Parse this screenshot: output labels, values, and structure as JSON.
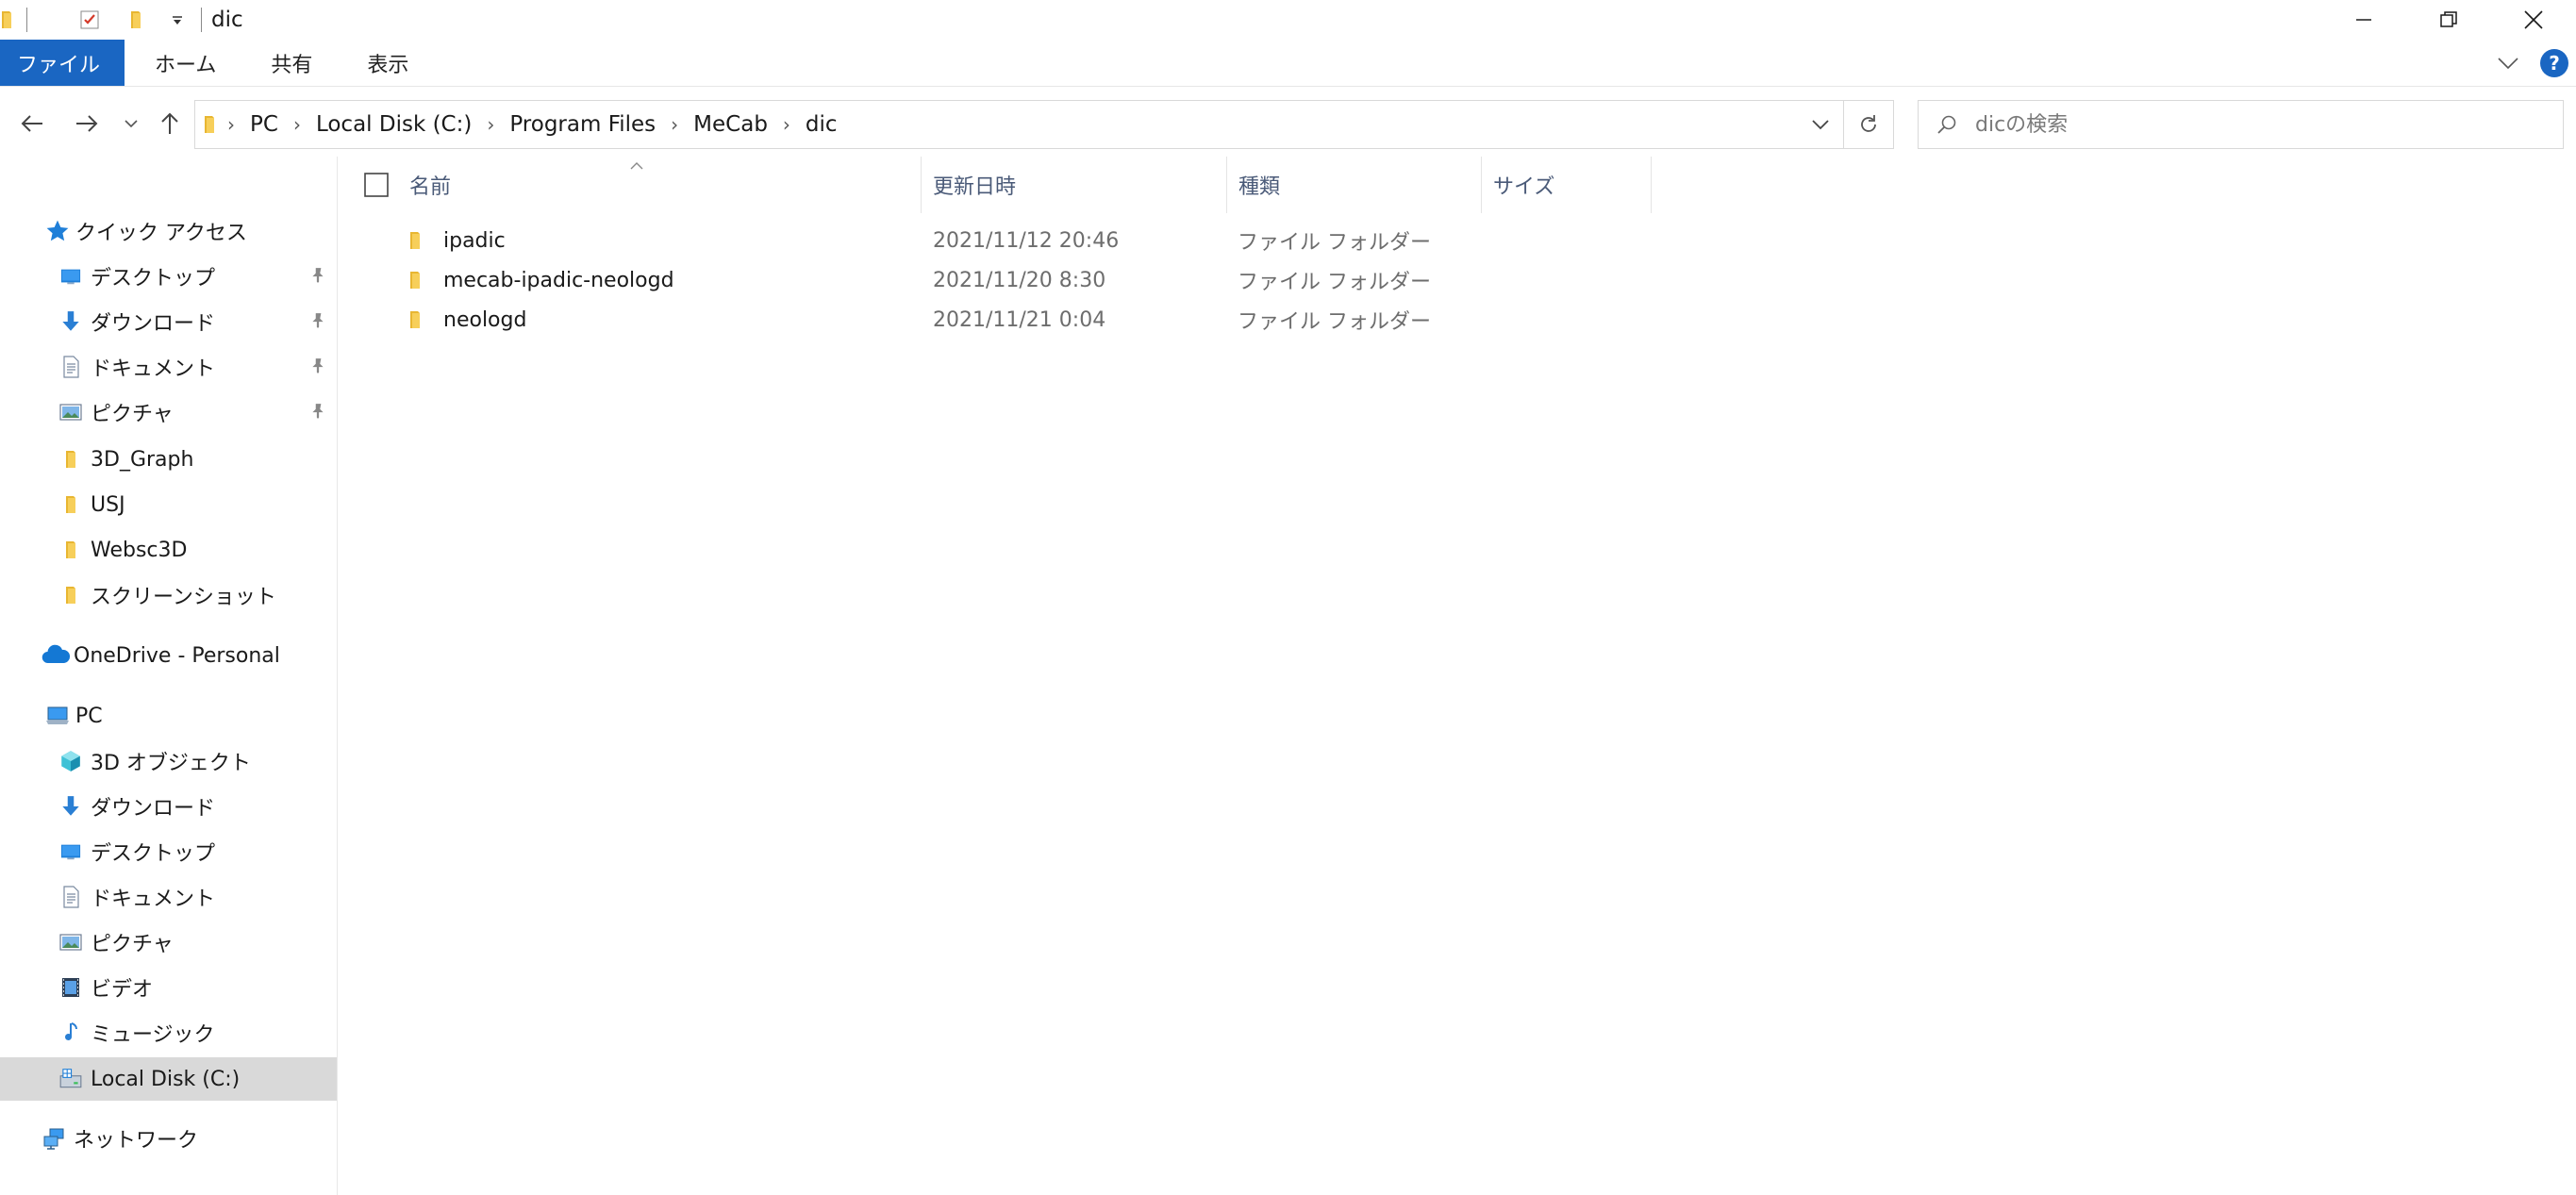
{
  "window": {
    "title": "dic",
    "controls": {
      "minimize": "minimize",
      "restore": "restore",
      "close": "close"
    }
  },
  "ribbon": {
    "tabs": [
      {
        "label": "ファイル",
        "active": true
      },
      {
        "label": "ホーム"
      },
      {
        "label": "共有"
      },
      {
        "label": "表示"
      }
    ],
    "help_label": "?"
  },
  "address": {
    "crumbs": [
      "PC",
      "Local Disk (C:)",
      "Program Files",
      "MeCab",
      "dic"
    ]
  },
  "search": {
    "placeholder": "dicの検索"
  },
  "navpane": {
    "quick_access": {
      "label": "クイック アクセス",
      "items": [
        {
          "label": "デスクトップ",
          "icon": "desktop-icon",
          "pinned": true
        },
        {
          "label": "ダウンロード",
          "icon": "download-icon",
          "pinned": true
        },
        {
          "label": "ドキュメント",
          "icon": "document-icon",
          "pinned": true
        },
        {
          "label": "ピクチャ",
          "icon": "pictures-icon",
          "pinned": true
        },
        {
          "label": "3D_Graph",
          "icon": "folder-icon"
        },
        {
          "label": "USJ",
          "icon": "folder-icon"
        },
        {
          "label": "Websc3D",
          "icon": "folder-icon"
        },
        {
          "label": "スクリーンショット",
          "icon": "folder-icon"
        }
      ]
    },
    "onedrive": {
      "label": "OneDrive - Personal"
    },
    "pc": {
      "label": "PC",
      "items": [
        {
          "label": "3D オブジェクト",
          "icon": "3d-objects-icon"
        },
        {
          "label": "ダウンロード",
          "icon": "download-icon"
        },
        {
          "label": "デスクトップ",
          "icon": "desktop-icon"
        },
        {
          "label": "ドキュメント",
          "icon": "document-icon"
        },
        {
          "label": "ピクチャ",
          "icon": "pictures-icon"
        },
        {
          "label": "ビデオ",
          "icon": "video-icon"
        },
        {
          "label": "ミュージック",
          "icon": "music-icon"
        },
        {
          "label": "Local Disk (C:)",
          "icon": "local-disk-icon",
          "selected": true
        }
      ]
    },
    "network": {
      "label": "ネットワーク"
    }
  },
  "list": {
    "columns": {
      "name": "名前",
      "date": "更新日時",
      "type": "種類",
      "size": "サイズ"
    },
    "rows": [
      {
        "name": "ipadic",
        "date": "2021/11/12 20:46",
        "type": "ファイル フォルダー"
      },
      {
        "name": "mecab-ipadic-neologd",
        "date": "2021/11/20 8:30",
        "type": "ファイル フォルダー"
      },
      {
        "name": "neologd",
        "date": "2021/11/21 0:04",
        "type": "ファイル フォルダー"
      }
    ]
  },
  "colors": {
    "accent": "#1a66c2",
    "folder": "#f5c542",
    "selected_bg": "#d9d9d9",
    "header_text": "#4a5a78"
  }
}
